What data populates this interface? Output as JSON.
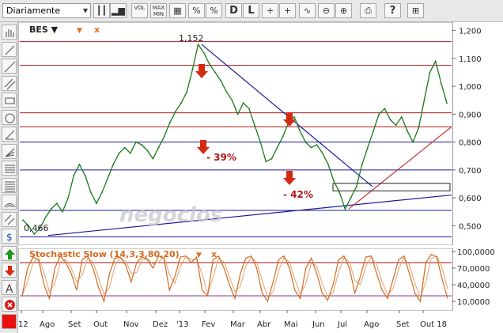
{
  "toolbar": {
    "period": "Diariamente",
    "buttons": [
      {
        "name": "candlestick-icon",
        "glyph": "┃┃"
      },
      {
        "name": "bar-chart-icon",
        "glyph": "▂▆"
      },
      {
        "name": "volume-button",
        "glyph": "VOL"
      },
      {
        "name": "minmax-button",
        "glyph": "MAX\nMIN"
      },
      {
        "name": "grid-icon",
        "glyph": "▦"
      },
      {
        "name": "percent-button",
        "glyph": "%"
      },
      {
        "name": "reverse-percent-button",
        "glyph": "%"
      },
      {
        "name": "daily-button",
        "glyph": "D"
      },
      {
        "name": "log-button",
        "glyph": "L"
      },
      {
        "name": "crosshair-icon",
        "glyph": "+"
      },
      {
        "name": "crosshair-label-icon",
        "glyph": "+"
      },
      {
        "name": "wave-icon",
        "glyph": "∿"
      },
      {
        "name": "zoom-out-icon",
        "glyph": "⊖"
      },
      {
        "name": "zoom-in-icon",
        "glyph": "⊕"
      },
      {
        "name": "print-icon",
        "glyph": "⎙"
      },
      {
        "name": "help-icon",
        "glyph": "?"
      },
      {
        "name": "settings-icon",
        "glyph": "⊞"
      }
    ]
  },
  "sidebar": {
    "tools": [
      "hand-icon",
      "line-icon",
      "line-extend-icon",
      "parallel-line-icon",
      "rectangle-icon",
      "circle-icon",
      "trend-line-icon",
      "fan-lines-icon",
      "fibonacci-icon",
      "retracement-icon",
      "arc-icon",
      "channel-icon",
      "dollar-icon",
      "arrow-up-icon",
      "arrow-down-icon",
      "text-tool-icon",
      "delete-icon",
      "color-picker-icon"
    ]
  },
  "colors": {
    "price_line": "#1a7a1a",
    "resistance": "#b01818",
    "support": "#1a1a9a",
    "trend_up": "#c83030",
    "arrow": "#d42a10",
    "osc_line": "#d46a20",
    "osc_band": "#a01010",
    "osc_lower_band": "#8a3a8a"
  },
  "chart_data": [
    {
      "type": "line",
      "symbol": "BES",
      "x_labels": [
        "12",
        "Ago",
        "Set",
        "Out",
        "Nov",
        "Dez",
        "'13",
        "Fev",
        "Mar",
        "Abr",
        "Mai",
        "Jun",
        "Jul",
        "Ago",
        "Set",
        "Out 18"
      ],
      "y_ticks": [
        "1,200",
        "1,100",
        "1,000",
        "0,900",
        "0,800",
        "0,700",
        "0,600",
        "0,500"
      ],
      "ylim": [
        0.43,
        1.23
      ],
      "annotations": {
        "max": "1,152",
        "min": "0,466",
        "drop1": "- 39%",
        "drop2": "- 42%"
      },
      "watermark": "negocios",
      "horizontal_levels": {
        "resistance": [
          1.16,
          1.075,
          0.905,
          0.855
        ],
        "support": [
          0.8,
          0.7,
          0.555,
          0.46
        ]
      },
      "close": [
        0.52,
        0.5,
        0.47,
        0.49,
        0.53,
        0.56,
        0.58,
        0.55,
        0.6,
        0.68,
        0.72,
        0.68,
        0.62,
        0.58,
        0.62,
        0.67,
        0.72,
        0.76,
        0.78,
        0.76,
        0.8,
        0.79,
        0.77,
        0.74,
        0.78,
        0.82,
        0.87,
        0.91,
        0.94,
        0.98,
        1.06,
        1.15,
        1.12,
        1.08,
        1.05,
        1.02,
        0.98,
        0.95,
        0.9,
        0.94,
        0.92,
        0.86,
        0.8,
        0.73,
        0.74,
        0.78,
        0.82,
        0.87,
        0.89,
        0.84,
        0.8,
        0.78,
        0.79,
        0.76,
        0.72,
        0.66,
        0.62,
        0.56,
        0.6,
        0.64,
        0.72,
        0.78,
        0.84,
        0.9,
        0.92,
        0.88,
        0.86,
        0.89,
        0.84,
        0.8,
        0.85,
        0.95,
        1.05,
        1.09,
        1.01,
        0.94
      ]
    },
    {
      "type": "line",
      "title": "Stochastic Slow (14,3,3,80,20)",
      "y_ticks": [
        "100,0000",
        "70,0000",
        "40,0000",
        "10,0000"
      ],
      "ylim": [
        0,
        100
      ],
      "levels": [
        80,
        20
      ],
      "k": [
        20,
        70,
        90,
        85,
        40,
        15,
        70,
        92,
        80,
        60,
        30,
        85,
        92,
        70,
        35,
        10,
        60,
        88,
        90,
        75,
        45,
        80,
        90,
        85,
        70,
        92,
        88,
        30,
        55,
        90,
        92,
        80,
        90,
        30,
        20,
        85,
        92,
        70,
        40,
        15,
        60,
        88,
        92,
        70,
        25,
        10,
        45,
        85,
        92,
        70,
        30,
        15,
        70,
        88,
        60,
        25,
        12,
        40,
        85,
        92,
        70,
        25,
        55,
        90,
        92,
        60,
        30,
        15,
        50,
        85,
        92,
        60,
        25,
        10,
        80,
        95,
        90,
        50,
        15
      ]
    }
  ]
}
